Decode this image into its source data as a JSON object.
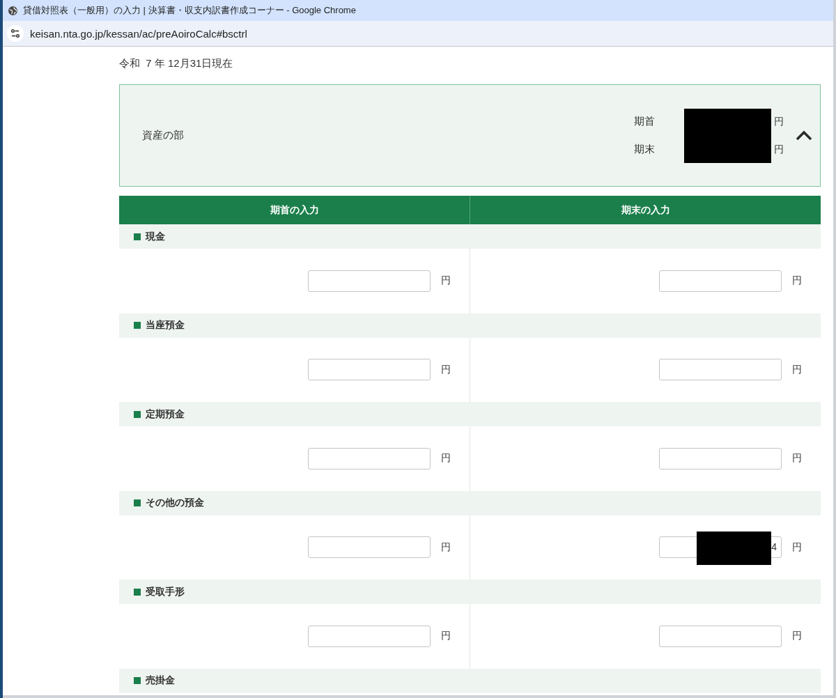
{
  "window": {
    "title": "貸借対照表（一般用）の入力 | 決算書・収支内訳書作成コーナー - Google Chrome"
  },
  "address_bar": {
    "url": "keisan.nta.go.jp/kessan/ac/preAoiroCalc#bsctrl"
  },
  "as_of": "令和  7 年 12月31日現在",
  "summary": {
    "title": "資産の部",
    "expanded": true,
    "redacted": true,
    "rows": [
      {
        "label": "期首",
        "unit": "円"
      },
      {
        "label": "期末",
        "unit": "円"
      }
    ]
  },
  "columns": [
    "期首の入力",
    "期末の入力"
  ],
  "sections": [
    {
      "label": "現金",
      "fields": [
        {
          "unit": "円"
        },
        {
          "unit": "円"
        }
      ]
    },
    {
      "label": "当座預金",
      "fields": [
        {
          "unit": "円"
        },
        {
          "unit": "円"
        }
      ]
    },
    {
      "label": "定期預金",
      "fields": [
        {
          "unit": "円"
        },
        {
          "unit": "円"
        }
      ]
    },
    {
      "label": "その他の預金",
      "fields": [
        {
          "unit": "円"
        },
        {
          "value": "4",
          "unit": "円",
          "redacted": true
        }
      ]
    },
    {
      "label": "受取手形",
      "fields": [
        {
          "unit": "円"
        },
        {
          "unit": "円"
        }
      ]
    },
    {
      "label": "売掛金"
    }
  ]
}
